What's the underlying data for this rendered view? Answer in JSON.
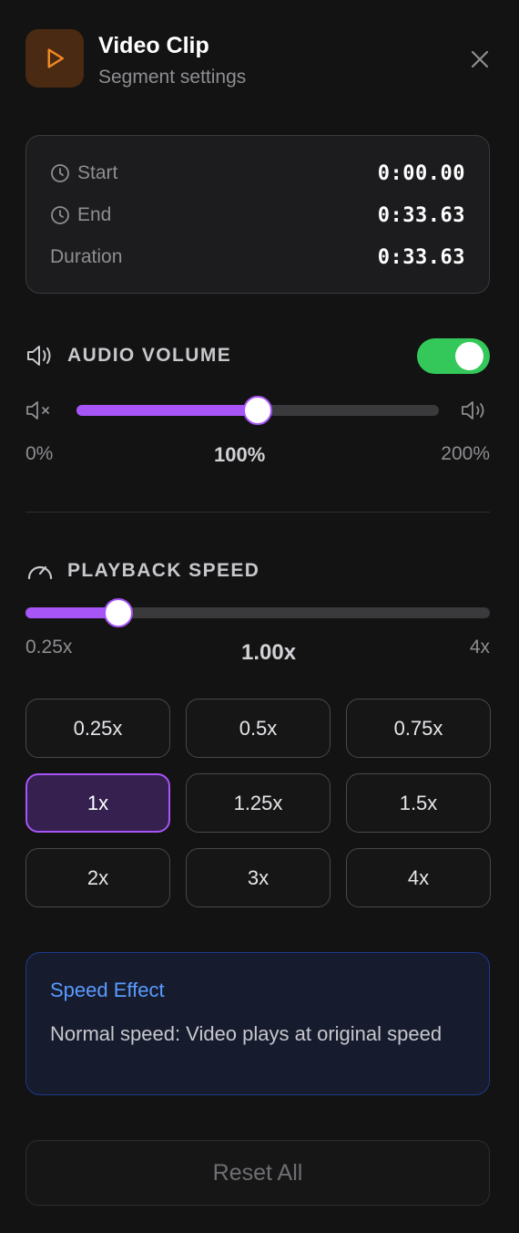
{
  "header": {
    "title": "Video Clip",
    "subtitle": "Segment settings",
    "app_icon": "play-icon",
    "close_icon": "close-icon"
  },
  "times": [
    {
      "label": "Start",
      "value": "0:00.00",
      "icon": "clock-icon"
    },
    {
      "label": "End",
      "value": "0:33.63",
      "icon": "clock-icon"
    },
    {
      "label": "Duration",
      "value": "0:33.63"
    }
  ],
  "audio": {
    "title": "AUDIO VOLUME",
    "enabled": true,
    "volume_percent": 100,
    "min_label": "0%",
    "mid_label": "100%",
    "max_label": "200%",
    "range": [
      0,
      200
    ]
  },
  "speed": {
    "title": "PLAYBACK SPEED",
    "current": "1.00x",
    "current_value": 1.0,
    "min_label": "0.25x",
    "max_label": "4x",
    "range": [
      0.25,
      4
    ],
    "options": [
      "0.25x",
      "0.5x",
      "0.75x",
      "1x",
      "1.25x",
      "1.5x",
      "2x",
      "3x",
      "4x"
    ],
    "selected": "1x"
  },
  "effect": {
    "title": "Speed Effect",
    "text": "Normal speed: Video plays at original speed"
  },
  "reset_label": "Reset All",
  "colors": {
    "accent": "#a855f7",
    "toggle_on": "#34c759",
    "play_icon": "#f08a24",
    "effect_title": "#5b9bff"
  }
}
